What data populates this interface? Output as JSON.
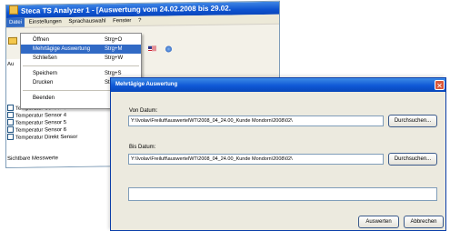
{
  "main_window": {
    "title": "Steca TS Analyzer 1 - [Auswertung vom 24.02.2008 bis 29.02.",
    "menu": [
      "Datei",
      "Einstellungen",
      "Sprachauswahl",
      "Fenster",
      "?"
    ],
    "panel_label_top": "Au",
    "panel_label_bottom": "Sichtbare Messwerte",
    "sensors": [
      "Temperatur Sensor 3",
      "Temperatur Sensor 4",
      "Temperatur Sensor 5",
      "Temperatur Sensor 6",
      "Temperatur Direkt Sensor"
    ]
  },
  "datei_menu": {
    "items": [
      {
        "label": "Öffnen",
        "shortcut": "Strg+O"
      },
      {
        "label": "Mehrtägige Auswertung",
        "shortcut": "Strg+M"
      },
      {
        "label": "Schließen",
        "shortcut": "Strg+W"
      },
      {
        "label": "Speichern",
        "shortcut": "Strg+S"
      },
      {
        "label": "Drucken",
        "shortcut": "Strg+P"
      },
      {
        "label": "Beenden",
        "shortcut": ""
      }
    ]
  },
  "dialog": {
    "title": "Mehrtägige Auswertung",
    "from_label": "Von Datum:",
    "from_value": "Y:\\Ivolav\\Freiluft\\auswertelWT\\2008_04_24.00_Kunde Mondorn\\2008\\02\\",
    "to_label": "Bis Datum:",
    "to_value": "Y:\\Ivolav\\Freiluft\\auswertelWT\\2008_04_24.00_Kunde Mondorn\\2008\\02\\",
    "browse_label": "Durchsuchen...",
    "ok_label": "Auswerten",
    "cancel_label": "Abbrechen",
    "close_glyph": "✕"
  },
  "colors": {
    "titlebar": "#0e53d0",
    "menu_highlight": "#316ac5",
    "dialog_background": "#eceadf"
  }
}
